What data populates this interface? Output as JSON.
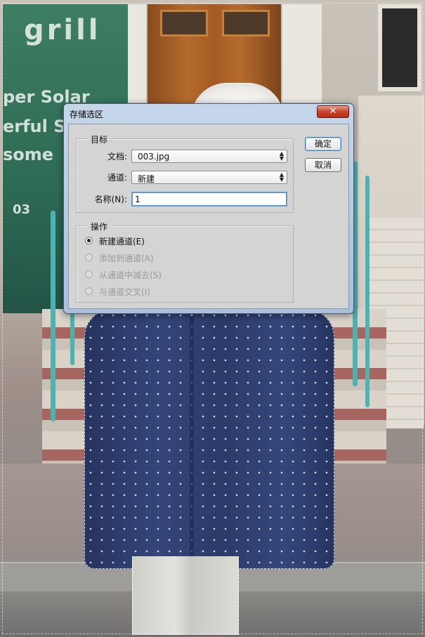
{
  "background": {
    "sign_words": [
      "grill",
      "per Solar",
      "erful S",
      "some",
      "03"
    ]
  },
  "dialog": {
    "title": "存储选区",
    "close_symbol": "✕",
    "target_group": {
      "legend": "目标",
      "document_label": "文档:",
      "document_value": "003.jpg",
      "channel_label": "通道:",
      "channel_value": "新建",
      "name_label": "名称(N):",
      "name_value": "1"
    },
    "operation_group": {
      "legend": "操作",
      "options": [
        {
          "label": "新建通道(E)",
          "checked": true,
          "enabled": true
        },
        {
          "label": "添加到通道(A)",
          "checked": false,
          "enabled": false
        },
        {
          "label": "从通道中减去(S)",
          "checked": false,
          "enabled": false
        },
        {
          "label": "与通道交叉(I)",
          "checked": false,
          "enabled": false
        }
      ]
    },
    "buttons": {
      "ok": "确定",
      "cancel": "取消"
    }
  },
  "colors": {
    "accent_focus": "#5e9bd8",
    "close_button": "#c9442c"
  }
}
